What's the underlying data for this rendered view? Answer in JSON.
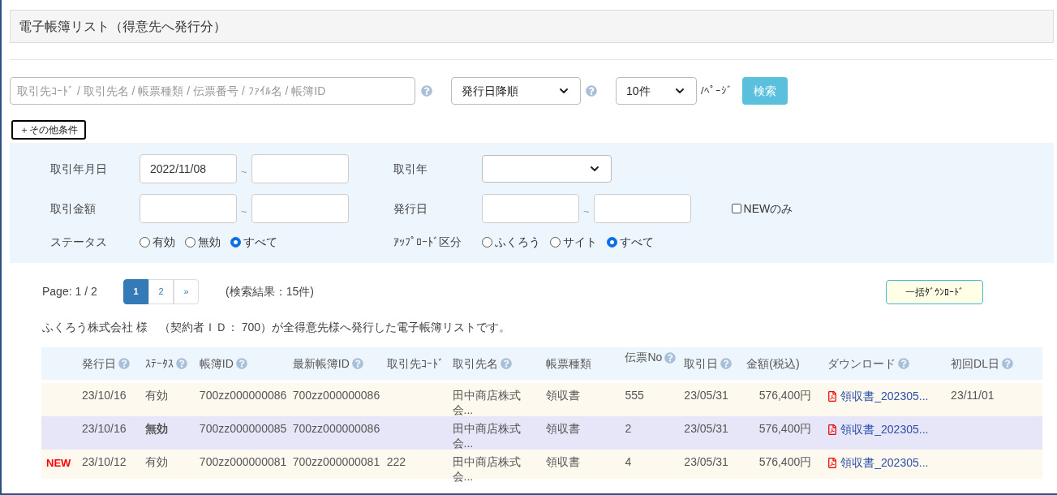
{
  "title": "電子帳簿リスト（得意先へ発行分）",
  "search": {
    "placeholder": "取引先ｺｰﾄﾞ / 取引先名 / 帳票種類 / 伝票番号 / ﾌｧｲﾙ名 / 帳簿ID",
    "sort": "発行日降順",
    "per_page": "10件",
    "per_page_suffix": "/ﾍﾟｰｼﾞ",
    "button": "検索"
  },
  "more_conditions": "＋その他条件",
  "filters": {
    "trade_date": {
      "label": "取引年月日",
      "from": "2022/11/08",
      "separator": "~"
    },
    "trade_year": {
      "label": "取引年"
    },
    "amount": {
      "label": "取引金額",
      "separator": "~"
    },
    "issue_date": {
      "label": "発行日",
      "separator": "~"
    },
    "new_only": {
      "label": "NEWのみ",
      "checked": false
    },
    "status": {
      "label": "ステータス",
      "options": [
        {
          "label": "有効",
          "selected": false
        },
        {
          "label": "無効",
          "selected": false
        },
        {
          "label": "すべて",
          "selected": true
        }
      ]
    },
    "upload": {
      "label": "ｱｯﾌﾟﾛｰﾄﾞ区分",
      "options": [
        {
          "label": "ふくろう",
          "selected": false
        },
        {
          "label": "サイト",
          "selected": false
        },
        {
          "label": "すべて",
          "selected": true
        }
      ]
    }
  },
  "pagination": {
    "page_info": "Page: 1 / 2",
    "pages": [
      {
        "label": "1",
        "selected": true
      },
      {
        "label": "2",
        "selected": false
      },
      {
        "label": "»",
        "selected": false
      }
    ],
    "result": "(検索結果：15件)"
  },
  "bulk_download": "一括ﾀﾞｳﾝﾛｰﾄﾞ",
  "description": "ふくろう株式会社 様　（契約者ＩＤ： 700）が全得意先様へ発行した電子帳簿リストです。",
  "table": {
    "columns": [
      {
        "label": "発行日",
        "help": true
      },
      {
        "label": "ｽﾃｰﾀｽ",
        "help": true
      },
      {
        "label": "帳簿ID",
        "help": true
      },
      {
        "label": "最新帳簿ID",
        "help": true
      },
      {
        "label": "取引先ｺｰﾄﾞ",
        "help": false
      },
      {
        "label": "取引先名",
        "help": true
      },
      {
        "label": "帳票種類",
        "help": false
      },
      {
        "label": "伝票No",
        "help": true
      },
      {
        "label": "取引日",
        "help": true
      },
      {
        "label": "金額(税込)",
        "help": false
      },
      {
        "label": "ダウンロード",
        "help": true
      },
      {
        "label": "初回DL日",
        "help": true
      }
    ],
    "rows": [
      {
        "new_badge": null,
        "invalid": false,
        "cells": [
          "23/10/16",
          "有効",
          "700zz000000086",
          "700zz000000086",
          null,
          "田中商店株式会...",
          "領収書",
          "555",
          "23/05/31",
          "576,400円",
          "領収書_202305...",
          "23/11/01"
        ]
      },
      {
        "new_badge": null,
        "invalid": true,
        "cells": [
          "23/10/16",
          "無効",
          "700zz000000085",
          "700zz000000086",
          null,
          "田中商店株式会...",
          "領収書",
          "2",
          "23/05/31",
          "576,400円",
          "領収書_202305...",
          null
        ]
      },
      {
        "new_badge": "NEW",
        "invalid": false,
        "cells": [
          "23/10/12",
          "有効",
          "700zz000000081",
          "700zz000000081",
          "222",
          "田中商店株式会...",
          "領収書",
          "4",
          "23/05/31",
          "576,400円",
          "領収書_202305...",
          null
        ]
      }
    ]
  }
}
